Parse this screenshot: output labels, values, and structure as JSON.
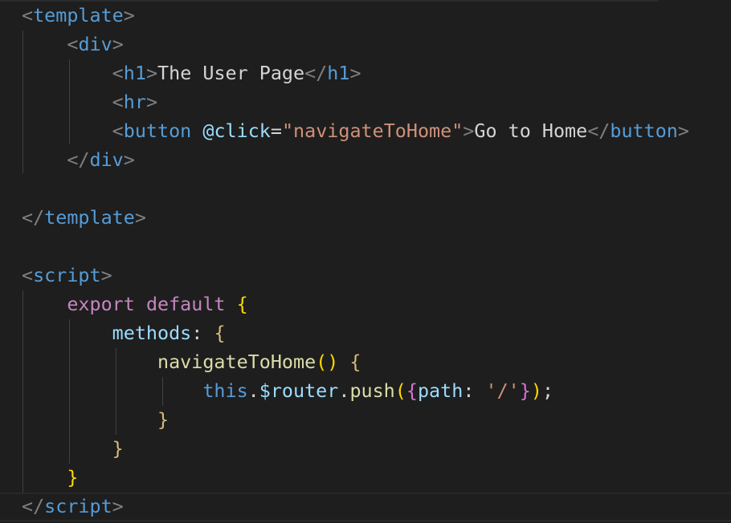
{
  "editor": {
    "language": "vue",
    "code": {
      "template_open": "template",
      "div": "div",
      "h1": "h1",
      "h1_text": "The User Page",
      "hr": "hr",
      "button": "button",
      "click_attr": "@click",
      "click_value": "\"navigateToHome\"",
      "button_text": "Go to Home",
      "template_close": "template",
      "script": "script",
      "export": "export",
      "default": "default",
      "methods": "methods",
      "method_name": "navigateToHome",
      "this": "this",
      "router": "$router",
      "push": "push",
      "path_key": "path",
      "path_value": "'/'"
    }
  },
  "colors": {
    "background": "#1e1e1e",
    "tag": "#569cd6",
    "punctuation": "#808080",
    "attribute": "#9cdcfe",
    "string": "#ce9178",
    "keyword": "#c586c0",
    "function": "#dcdcaa",
    "bracket": "#ffd700",
    "text": "#d4d4d4"
  }
}
